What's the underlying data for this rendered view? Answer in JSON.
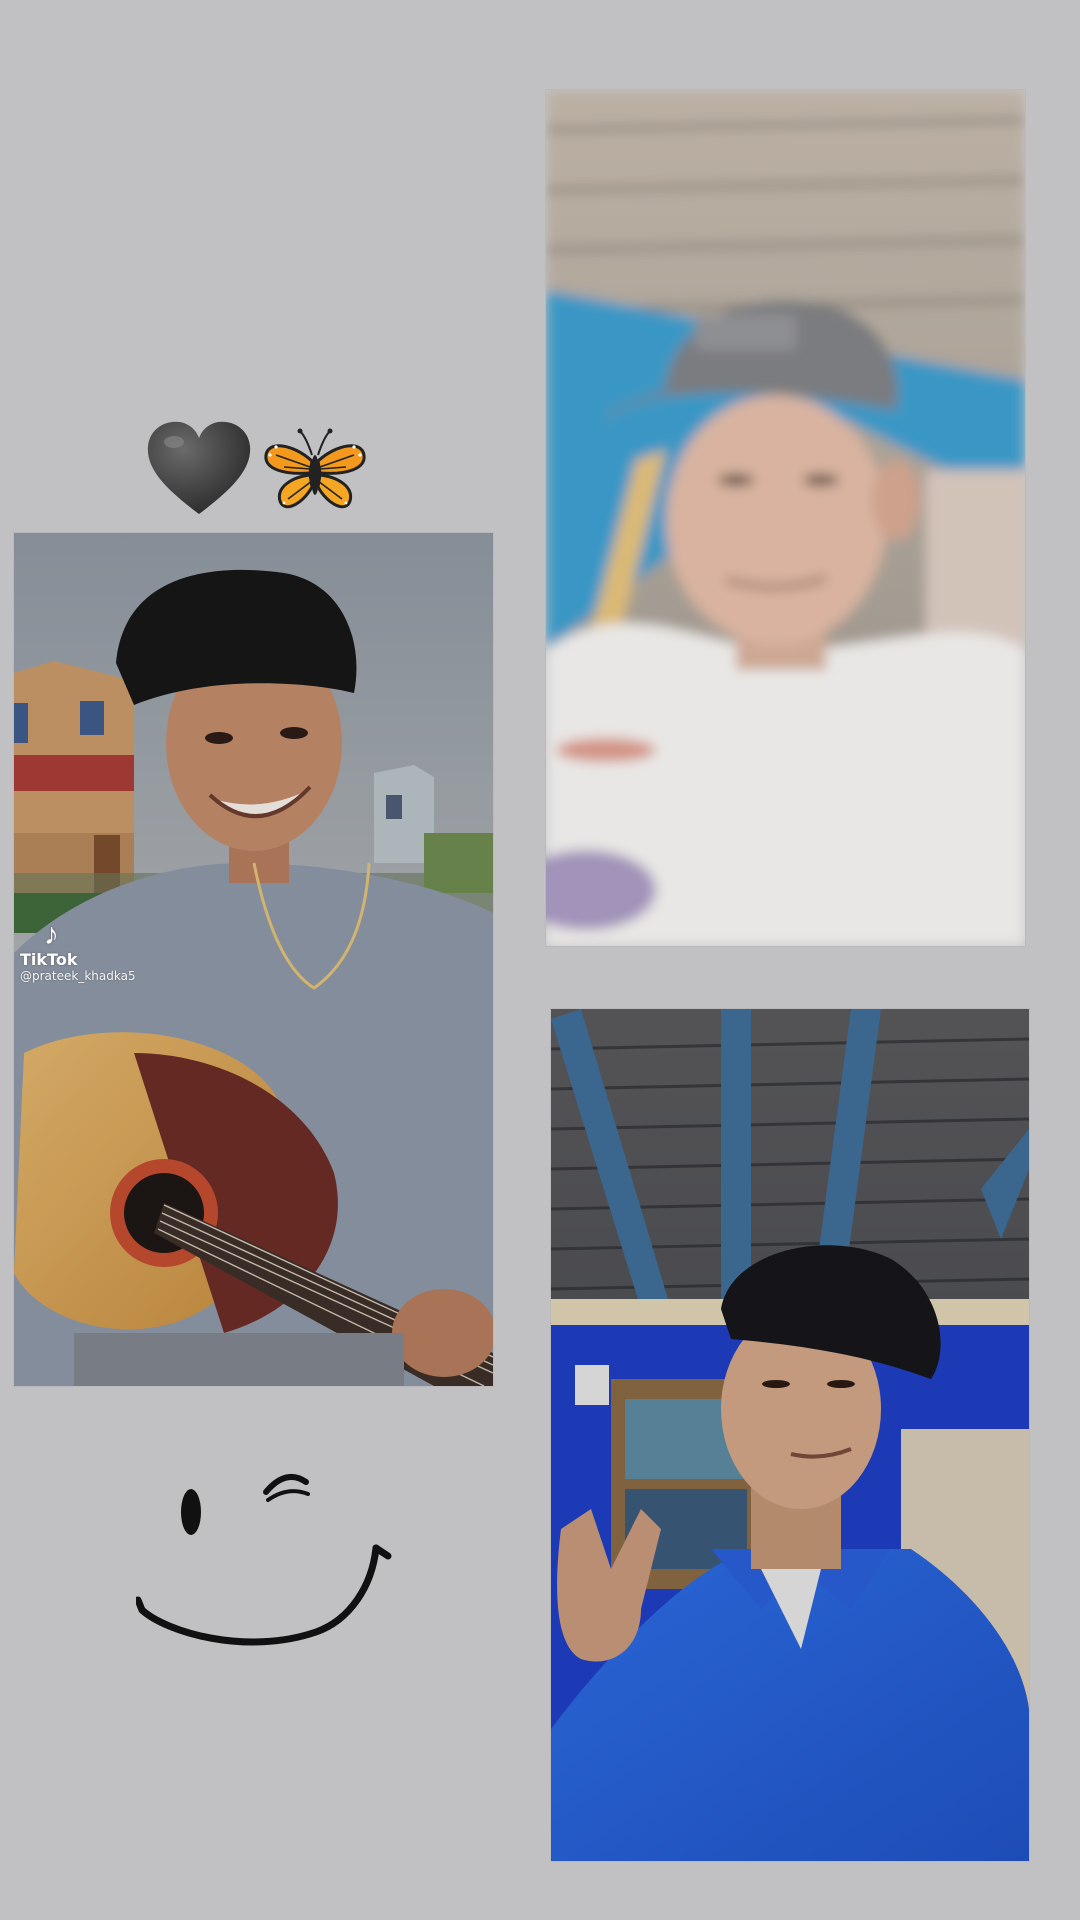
{
  "watermark": {
    "logo_icon": "tiktok-note-icon",
    "brand": "TikTok",
    "handle": "@prateek_khadka5"
  },
  "stickers": {
    "heart": "black-heart-icon",
    "butterfly": "butterfly-icon",
    "smiley": "wink-smiley-icon"
  },
  "colors": {
    "background": "#c1c1c3",
    "heart": "#4a4a4a",
    "butterfly": "#f39a1e",
    "smiley_stroke": "#111111"
  }
}
